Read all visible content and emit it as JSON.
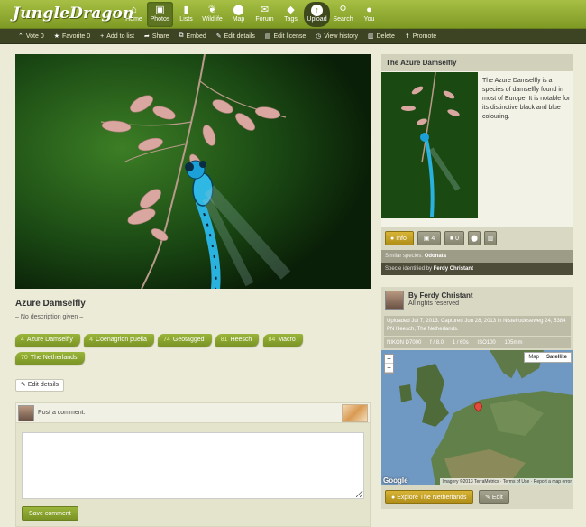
{
  "site": {
    "logo": "JungleDragon"
  },
  "nav": [
    {
      "label": "Home",
      "icon": "home-icon",
      "glyph": "⌂"
    },
    {
      "label": "Photos",
      "icon": "camera-icon",
      "glyph": "▣"
    },
    {
      "label": "Lists",
      "icon": "bookmark-icon",
      "glyph": "▮"
    },
    {
      "label": "Wildlife",
      "icon": "leaf-icon",
      "glyph": "❦"
    },
    {
      "label": "Map",
      "icon": "map-pin-icon",
      "glyph": "⬤"
    },
    {
      "label": "Forum",
      "icon": "chat-icon",
      "glyph": "✉"
    },
    {
      "label": "Tags",
      "icon": "tag-icon",
      "glyph": "◆"
    },
    {
      "label": "Upload",
      "icon": "upload-icon",
      "glyph": "↑"
    },
    {
      "label": "Search",
      "icon": "search-icon",
      "glyph": "⚲"
    },
    {
      "label": "You",
      "icon": "user-icon",
      "glyph": "●"
    }
  ],
  "actions": [
    {
      "label": "Vote 0",
      "glyph": "⌃"
    },
    {
      "label": "Favorite 0",
      "glyph": "★"
    },
    {
      "label": "Add to list",
      "glyph": "+"
    },
    {
      "label": "Share",
      "glyph": "➦"
    },
    {
      "label": "Embed",
      "glyph": "⧉"
    },
    {
      "label": "Edit details",
      "glyph": "✎"
    },
    {
      "label": "Edit license",
      "glyph": "▤"
    },
    {
      "label": "View history",
      "glyph": "◷"
    },
    {
      "label": "Delete",
      "glyph": "▥"
    },
    {
      "label": "Promote",
      "glyph": "⬆"
    }
  ],
  "photo": {
    "title": "Azure Damselfly",
    "description": "– No description given –"
  },
  "tags": [
    {
      "count": "4",
      "label": "Azure Damselfly"
    },
    {
      "count": "4",
      "label": "Coenagrion puella"
    },
    {
      "count": "74",
      "label": "Geotagged"
    },
    {
      "count": "81",
      "label": "Heesch"
    },
    {
      "count": "84",
      "label": "Macro"
    },
    {
      "count": "70",
      "label": "The Netherlands"
    }
  ],
  "edit_details_label": "Edit details",
  "comment": {
    "post_label": "Post a comment:",
    "save_label": "Save comment"
  },
  "species": {
    "title": "The Azure Damselfly",
    "text": "The Azure Damselfly is a species of damselfly found in most of Europe. It is notable for its distinctive black and blue colouring.",
    "info_label": "Info",
    "photo_count": "4",
    "video_count": "0",
    "similar_prefix": "Similar species:",
    "similar_value": "Odonata",
    "identified_prefix": "Specie identified by",
    "identified_value": "Ferdy Christant"
  },
  "author": {
    "name": "By Ferdy Christant",
    "rights": "All rights reserved",
    "meta": "Uploaded Jul 7, 2013. Captured Jun 28, 2013 in Nistelrodeseweg 24, 5384 PN Heesch, The Netherlands.",
    "exif": [
      "NIKON D7000",
      "f / 8.0",
      "1 / 60s",
      "ISO100",
      "105mm"
    ]
  },
  "map": {
    "type_map": "Map",
    "type_satellite": "Satellite",
    "zoom_in": "+",
    "zoom_out": "−",
    "brand": "Google",
    "attribution": "Imagery ©2013 TerraMetrics · Terms of Use · Report a map error",
    "explore_label": "Explore The Netherlands",
    "edit_label": "Edit"
  },
  "colors": {
    "header": "#8aa42c",
    "actionbar": "#3d4424",
    "accent_green": "#7a9325",
    "accent_gold": "#c49f22"
  }
}
